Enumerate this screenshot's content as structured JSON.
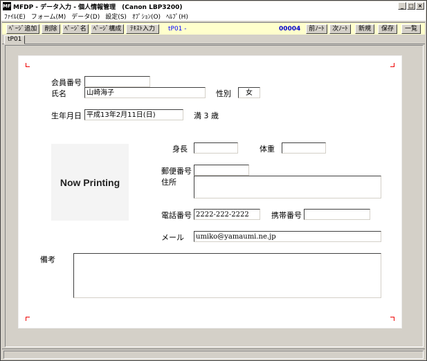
{
  "window": {
    "title": "MFDP - データ入力 - 個人情報管理　(Canon LBP3200)",
    "app_icon": "MFDP",
    "minimize": "_",
    "maximize": "□",
    "close": "×"
  },
  "menu": [
    "ﾌｧｲﾙ(E)",
    "フォーム(M)",
    "データ(D)",
    "設定(S)",
    "ｵﾌﾟｼｮﾝ(O)",
    "ﾍﾙﾌﾟ(H)"
  ],
  "toolbar": {
    "buttons": [
      "ﾍﾟｰｼﾞ追加",
      "削除",
      "ﾍﾟｰｼﾞ名",
      "ﾍﾟｰｼﾞ構成",
      "ﾃｷｽﾄ入力"
    ],
    "page_indicator": "tP01 -",
    "record_number": "00004",
    "prev_label": "前ﾉｰﾄ",
    "next_label": "次ﾉｰﾄ",
    "new_label": "新規",
    "save_label": "保存",
    "list_label": "一覧"
  },
  "tabs": [
    "tP01"
  ],
  "form": {
    "member_no_label": "会員番号",
    "member_no_value": "",
    "name_label": "氏名",
    "name_value": "山崎海子",
    "gender_label": "性別",
    "gender_value": "女",
    "birth_label": "生年月日",
    "birth_value": "平成13年2月11日(日)",
    "age_text": "満 3 歳",
    "photo_text": "Now Printing",
    "height_label": "身長",
    "height_value": "",
    "weight_label": "体重",
    "weight_value": "",
    "postal_label": "郵便番号",
    "postal_value": "",
    "address_label": "住所",
    "address_value": "",
    "phone_label": "電話番号",
    "phone_value": "2222-222-2222",
    "mobile_label": "携帯番号",
    "mobile_value": "",
    "email_label": "メール",
    "email_value": "umiko@yamaumi.ne.jp",
    "notes_label": "備考",
    "notes_value": ""
  }
}
